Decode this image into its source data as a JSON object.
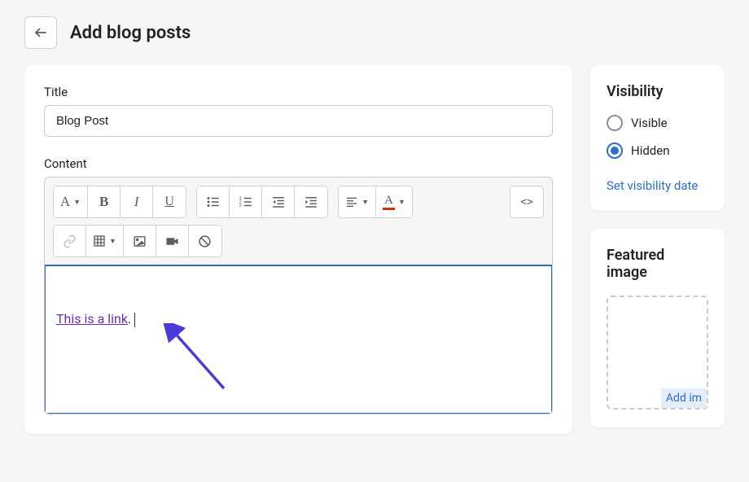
{
  "header": {
    "title": "Add blog posts"
  },
  "form": {
    "title_label": "Title",
    "title_value": "Blog Post",
    "content_label": "Content"
  },
  "editor": {
    "link_text": "This is a link",
    "after_text": "."
  },
  "visibility": {
    "heading": "Visibility",
    "options": [
      {
        "label": "Visible",
        "selected": false
      },
      {
        "label": "Hidden",
        "selected": true
      }
    ],
    "set_date": "Set visibility date"
  },
  "featured_image": {
    "heading": "Featured image",
    "add_label": "Add im"
  },
  "toolbar": {
    "style_letter": "A",
    "bold": "B",
    "italic": "I",
    "underline": "U",
    "color_letter": "A",
    "html": "<>"
  }
}
